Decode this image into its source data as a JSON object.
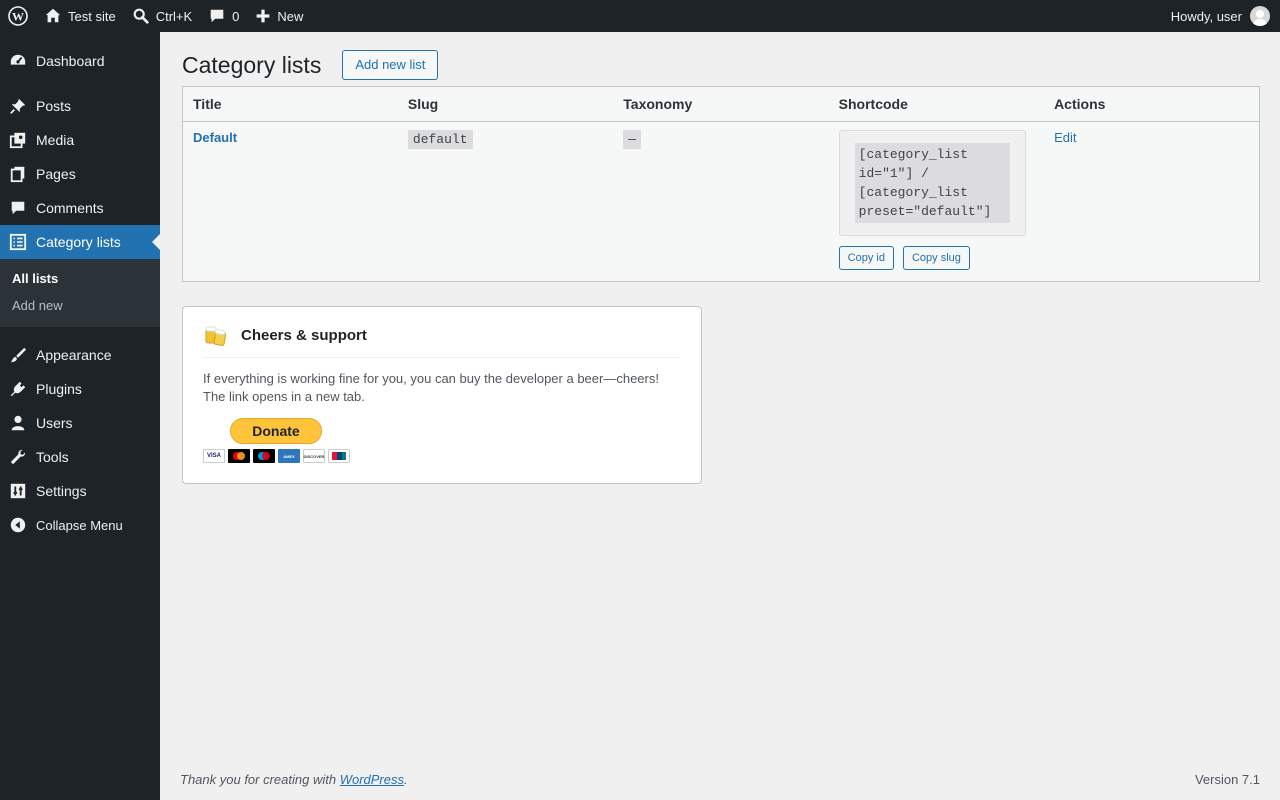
{
  "adminbar": {
    "site_name": "Test site",
    "search_shortcut": "Ctrl+K",
    "comments_count": "0",
    "new_label": "New",
    "greeting": "Howdy, user"
  },
  "sidebar": {
    "items": [
      {
        "label": "Dashboard",
        "icon": "dashboard-icon"
      },
      {
        "label": "Posts",
        "icon": "pin-icon"
      },
      {
        "label": "Media",
        "icon": "media-icon"
      },
      {
        "label": "Pages",
        "icon": "pages-icon"
      },
      {
        "label": "Comments",
        "icon": "comment-icon"
      },
      {
        "label": "Category lists",
        "icon": "list-icon"
      },
      {
        "label": "Appearance",
        "icon": "brush-icon"
      },
      {
        "label": "Plugins",
        "icon": "plug-icon"
      },
      {
        "label": "Users",
        "icon": "user-icon"
      },
      {
        "label": "Tools",
        "icon": "wrench-icon"
      },
      {
        "label": "Settings",
        "icon": "sliders-icon"
      }
    ],
    "submenu": [
      "All lists",
      "Add new"
    ],
    "collapse_label": "Collapse Menu"
  },
  "main": {
    "title": "Category lists",
    "add_new_label": "Add new list",
    "table": {
      "columns": [
        "Title",
        "Slug",
        "Taxonomy",
        "Shortcode",
        "Actions"
      ],
      "rows": [
        {
          "title": "Default",
          "slug": "default",
          "taxonomy": "—",
          "shortcode": "[category_list\nid=\"1\"] /\n[category_list\npreset=\"default\"]",
          "copy_id_label": "Copy id",
          "copy_slug_label": "Copy slug",
          "action": "Edit"
        }
      ]
    },
    "support": {
      "heading": "Cheers & support",
      "text": "If everything is working fine for you, you can buy the developer a beer—cheers! The link opens in a new tab.",
      "donate_label": "Donate",
      "card_brands": [
        "VISA",
        "MC",
        "MAESTRO",
        "AMEX",
        "DISCOVER",
        "UNIONPAY"
      ]
    }
  },
  "footer": {
    "thanks_prefix": "Thank you for creating with ",
    "thanks_link": "WordPress",
    "thanks_suffix": ".",
    "version": "Version 7.1"
  },
  "colors": {
    "accent": "#2271b1",
    "adminbar_bg": "#1d2327",
    "donate": "#ffc439"
  }
}
